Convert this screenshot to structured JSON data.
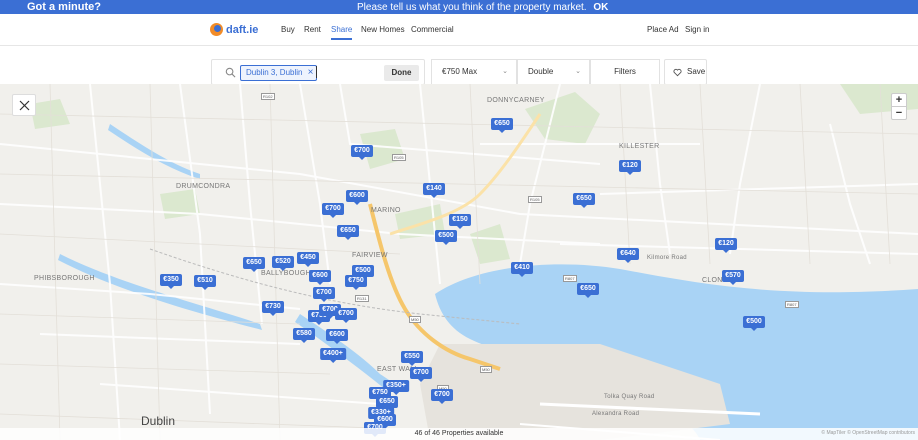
{
  "banner": {
    "prompt": "Got a minute?",
    "message": "Please tell us what you think of the property market.",
    "ok_label": "OK"
  },
  "header": {
    "logo_text": "daft.ie",
    "nav": [
      "Buy",
      "Rent",
      "Share",
      "New Homes",
      "Commercial"
    ],
    "active_nav": "Share",
    "place_ad": "Place Ad",
    "sign_in": "Sign in"
  },
  "search": {
    "chip_label": "Dublin 3, Dublin",
    "value": "",
    "done_label": "Done"
  },
  "filters": {
    "price": "€750 Max",
    "room_type": "Double",
    "filters_label": "Filters",
    "save_label": "Save"
  },
  "map": {
    "zoom_in": "+",
    "zoom_out": "−",
    "places": [
      "DONNYCARNEY",
      "KILLESTER",
      "DRUMCONDRA",
      "MARINO",
      "FAIRVIEW",
      "BALLYBOUGH",
      "PHIBSBOROUGH",
      "CLONTARF",
      "EAST WALL",
      "Dublin"
    ],
    "streets": [
      "Kilmore Road",
      "Tolka Quay Road",
      "Alexandra Road"
    ],
    "road_tags": [
      "R102",
      "R105",
      "R105",
      "R807",
      "R807",
      "R131",
      "M50",
      "M50",
      "M50"
    ],
    "pins": [
      "€650",
      "€700",
      "€120",
      "€600",
      "€140",
      "€650",
      "€700",
      "€150",
      "€650",
      "€500",
      "€640",
      "€120",
      "€450",
      "€650",
      "€520",
      "€500",
      "€350",
      "€510",
      "€600",
      "€410",
      "€750",
      "€570",
      "€700",
      "€650",
      "€730",
      "€750",
      "€700",
      "€700",
      "€580",
      "€600",
      "€500",
      "€400+",
      "€550",
      "€700",
      "€350+",
      "€750",
      "€700",
      "€650",
      "€330+",
      "€600",
      "€700"
    ],
    "status": "46 of 46 Properties available",
    "attribution": "© MapTiler © OpenStreetMap contributors"
  }
}
